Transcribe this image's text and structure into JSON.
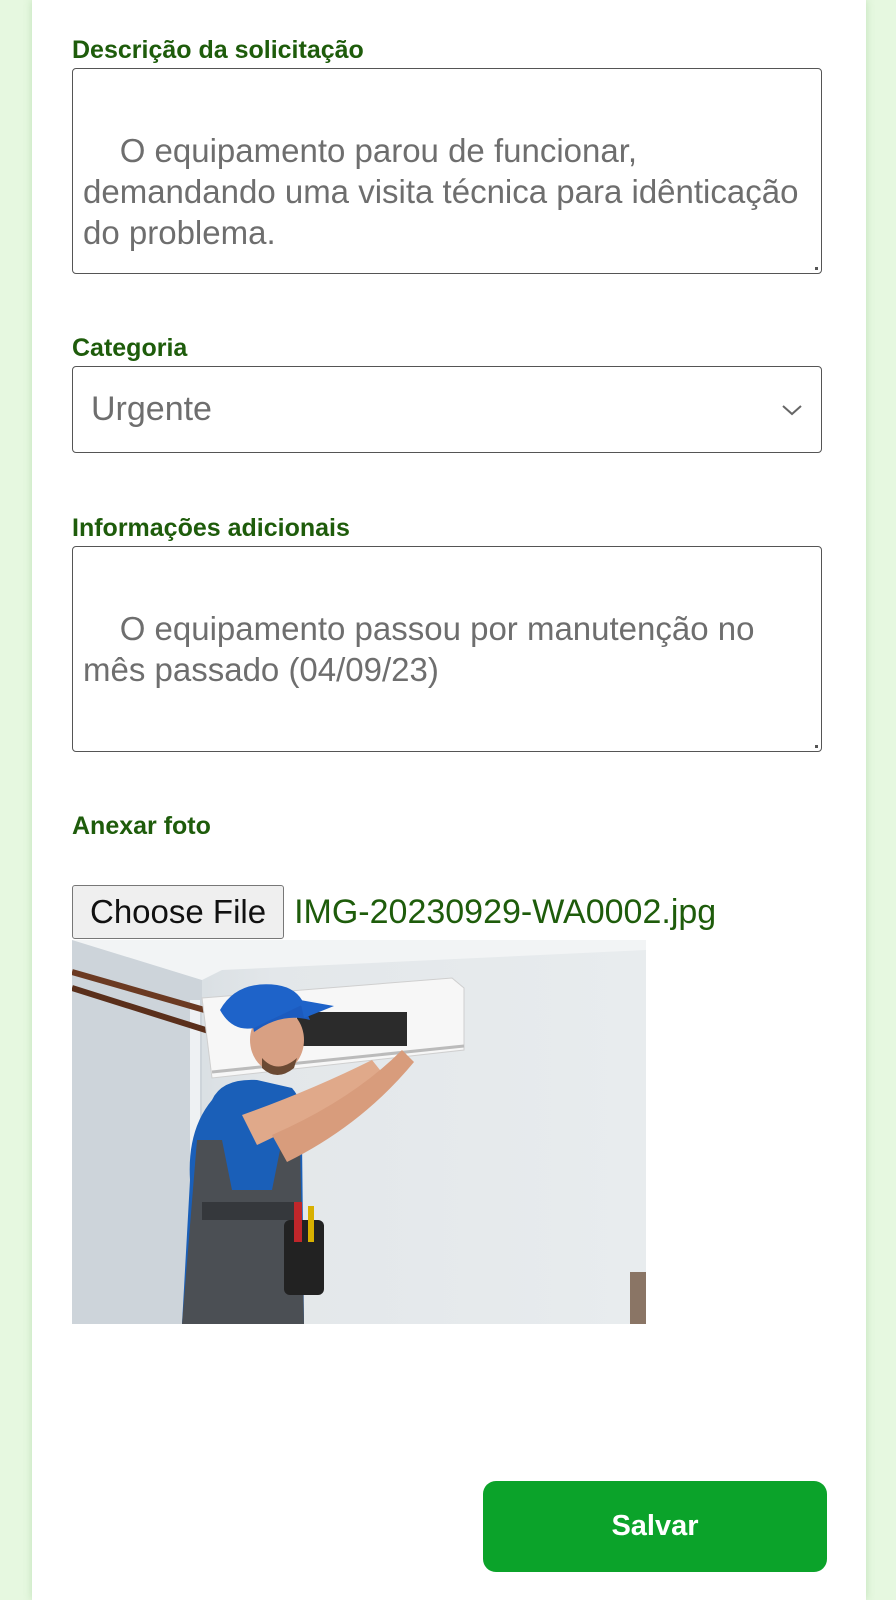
{
  "form": {
    "description": {
      "label": "Descrição da solicitação",
      "value": "O equipamento parou de funcionar, demandando uma visita técnica para idênticação do problema."
    },
    "category": {
      "label": "Categoria",
      "selected": "Urgente",
      "icon": "chevron-down-icon"
    },
    "additional_info": {
      "label": "Informações adicionais",
      "value": "O equipamento passou por manutenção no mês passado (04/09/23)"
    },
    "photo": {
      "label": "Anexar foto",
      "choose_label": "Choose File",
      "file_name": "IMG-20230929-WA0002.jpg"
    },
    "save_label": "Salvar"
  },
  "colors": {
    "page_background": "#e6f8e0",
    "label_green": "#1e5c0b",
    "button_green": "#0ba32a"
  }
}
